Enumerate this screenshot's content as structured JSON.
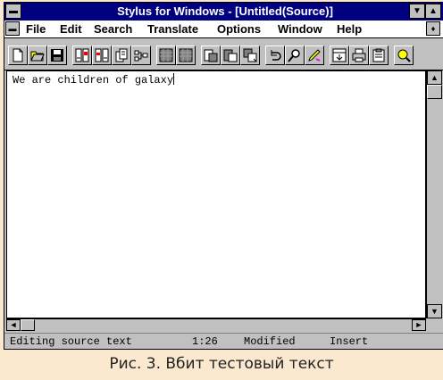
{
  "window": {
    "title": "Stylus for Windows - [Untitled(Source)]"
  },
  "menu": [
    {
      "label": "File"
    },
    {
      "label": "Edit"
    },
    {
      "label": "Search"
    },
    {
      "label": "Translate"
    },
    {
      "label": "Options"
    },
    {
      "label": "Window"
    },
    {
      "label": "Help"
    }
  ],
  "toolbar": {
    "icons": [
      "new-document-icon",
      "open-file-icon",
      "save-icon",
      "translate-block-icon",
      "translate-line-icon",
      "dictionary-icon",
      "tree-icon",
      "grid-icon",
      "grid-icon",
      "document-view-icon",
      "document-view-icon",
      "document-view-icon",
      "undo-icon",
      "find-icon",
      "highlighter-icon",
      "print-preview-icon",
      "print-icon",
      "clipboard-icon",
      "zoom-icon"
    ]
  },
  "editor": {
    "text": "We are children of galaxy"
  },
  "status": {
    "mode_text": "Editing source text",
    "position": "1:26",
    "modified": "Modified",
    "insert": "Insert"
  },
  "caption": "Рис. 3. Вбит тестовый текст"
}
